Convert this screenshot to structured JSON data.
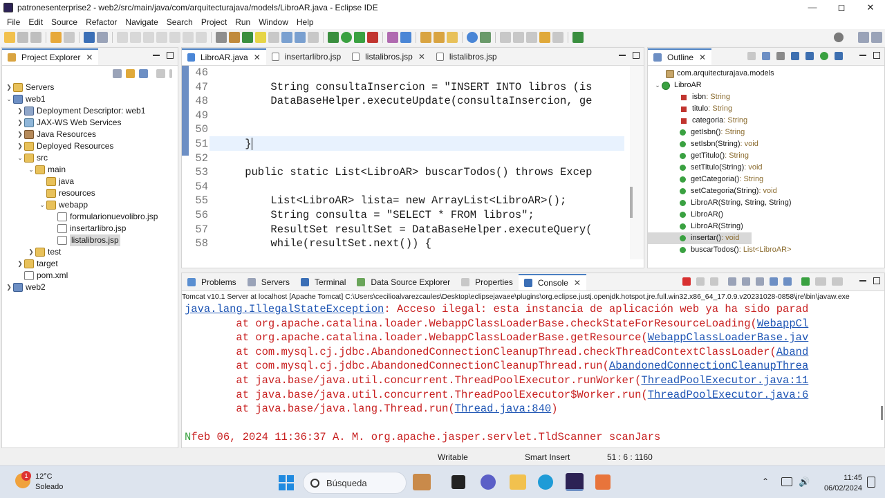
{
  "window": {
    "title": "patronesenterprise2 - web2/src/main/java/com/arquitecturajava/models/LibroAR.java - Eclipse IDE"
  },
  "menu": [
    "File",
    "Edit",
    "Source",
    "Refactor",
    "Navigate",
    "Search",
    "Project",
    "Run",
    "Window",
    "Help"
  ],
  "explorer": {
    "tab": "Project Explorer",
    "items": [
      {
        "label": "Servers",
        "icon": "folder"
      },
      {
        "label": "web1",
        "icon": "project"
      },
      {
        "label": "Deployment Descriptor: web1",
        "icon": "descriptor"
      },
      {
        "label": "JAX-WS Web Services",
        "icon": "web-services"
      },
      {
        "label": "Java Resources",
        "icon": "java-resources"
      },
      {
        "label": "Deployed Resources",
        "icon": "folder"
      },
      {
        "label": "src",
        "icon": "folder"
      },
      {
        "label": "main",
        "icon": "folder"
      },
      {
        "label": "java",
        "icon": "folder"
      },
      {
        "label": "resources",
        "icon": "folder"
      },
      {
        "label": "webapp",
        "icon": "folder"
      },
      {
        "label": "formularionuevolibro.jsp",
        "icon": "file"
      },
      {
        "label": "insertarlibro.jsp",
        "icon": "file"
      },
      {
        "label": "listalibros.jsp",
        "icon": "file"
      },
      {
        "label": "test",
        "icon": "folder"
      },
      {
        "label": "target",
        "icon": "folder"
      },
      {
        "label": "pom.xml",
        "icon": "file"
      },
      {
        "label": "web2",
        "icon": "project"
      }
    ]
  },
  "editor": {
    "tabs": [
      "LibroAR.java",
      "insertarlibro.jsp",
      "listalibros.jsp",
      "listalibros.jsp"
    ],
    "lines": [
      {
        "n": "46",
        "code": ""
      },
      {
        "n": "47",
        "code": "        String consultaInsercion = \"INSERT INTO libros (is"
      },
      {
        "n": "48",
        "code": "        DataBaseHelper.executeUpdate(consultaInsercion, ge"
      },
      {
        "n": "49",
        "code": ""
      },
      {
        "n": "50",
        "code": ""
      },
      {
        "n": "51",
        "code": "    }"
      },
      {
        "n": "52",
        "code": ""
      },
      {
        "n": "53",
        "code": "    public static List<LibroAR> buscarTodos() throws Excep"
      },
      {
        "n": "54",
        "code": ""
      },
      {
        "n": "55",
        "code": "        List<LibroAR> lista= new ArrayList<LibroAR>();"
      },
      {
        "n": "56",
        "code": "        String consulta = \"SELECT * FROM libros\";"
      },
      {
        "n": "57",
        "code": "        ResultSet resultSet = DataBaseHelper.executeQuery("
      },
      {
        "n": "58",
        "code": "        while(resultSet.next()) {"
      }
    ]
  },
  "outline": {
    "tab": "Outline",
    "package": "com.arquitecturajava.models",
    "class": "LibroAR",
    "members": [
      {
        "name": "isbn",
        "type": " : String",
        "kind": "field"
      },
      {
        "name": "titulo",
        "type": " : String",
        "kind": "field"
      },
      {
        "name": "categoria",
        "type": " : String",
        "kind": "field"
      },
      {
        "name": "getIsbn()",
        "type": " : String",
        "kind": "method"
      },
      {
        "name": "setIsbn(String)",
        "type": " : void",
        "kind": "method"
      },
      {
        "name": "getTitulo()",
        "type": " : String",
        "kind": "method"
      },
      {
        "name": "setTitulo(String)",
        "type": " : void",
        "kind": "method"
      },
      {
        "name": "getCategoria()",
        "type": " : String",
        "kind": "method"
      },
      {
        "name": "setCategoria(String)",
        "type": " : void",
        "kind": "method"
      },
      {
        "name": "LibroAR(String, String, String)",
        "type": "",
        "kind": "ctor"
      },
      {
        "name": "LibroAR()",
        "type": "",
        "kind": "ctor"
      },
      {
        "name": "LibroAR(String)",
        "type": "",
        "kind": "ctor"
      },
      {
        "name": "insertar()",
        "type": " : void",
        "kind": "method"
      },
      {
        "name": "buscarTodos()",
        "type": " : List<LibroAR>",
        "kind": "static"
      }
    ]
  },
  "bottom": {
    "tabs": [
      "Problems",
      "Servers",
      "Terminal",
      "Data Source Explorer",
      "Properties",
      "Console"
    ],
    "console_header": "Tomcat v10.1 Server at localhost [Apache Tomcat] C:\\Users\\cecilioalvarezcaules\\Desktop\\eclipsejavaee\\plugins\\org.eclipse.justj.openjdk.hotspot.jre.full.win32.x86_64_17.0.9.v20231028-0858\\jre\\bin\\javaw.exe",
    "exception": "java.lang.IllegalStateException",
    "exception_msg": ": Acceso ilegal: esta instancia de aplicación web ya ha sido parad",
    "stack": [
      {
        "at": "        at org.apache.catalina.loader.WebappClassLoaderBase.checkStateForResourceLoading(",
        "link": "WebappCl"
      },
      {
        "at": "        at org.apache.catalina.loader.WebappClassLoaderBase.getResource(",
        "link": "WebappClassLoaderBase.jav"
      },
      {
        "at": "        at com.mysql.cj.jdbc.AbandonedConnectionCleanupThread.checkThreadContextClassLoader(",
        "link": "Aband"
      },
      {
        "at": "        at com.mysql.cj.jdbc.AbandonedConnectionCleanupThread.run(",
        "link": "AbandonedConnectionCleanupThrea"
      },
      {
        "at": "        at java.base/java.util.concurrent.ThreadPoolExecutor.runWorker(",
        "link": "ThreadPoolExecutor.java:11"
      },
      {
        "at": "        at java.base/java.util.concurrent.ThreadPoolExecutor$Worker.run(",
        "link": "ThreadPoolExecutor.java:6"
      },
      {
        "at": "        at java.base/java.lang.Thread.run(",
        "link": "Thread.java:840",
        "tail": ")"
      }
    ],
    "last_line": "feb 06, 2024 11:36:37 A. M. org.apache.jasper.servlet.TldScanner scanJars"
  },
  "status": {
    "writable": "Writable",
    "insert": "Smart Insert",
    "position": "51 : 6 : 1160"
  },
  "taskbar": {
    "weather_temp": "12°C",
    "weather_desc": "Soleado",
    "weather_badge": "1",
    "search": "Búsqueda",
    "time": "11:45",
    "date": "06/02/2024"
  }
}
